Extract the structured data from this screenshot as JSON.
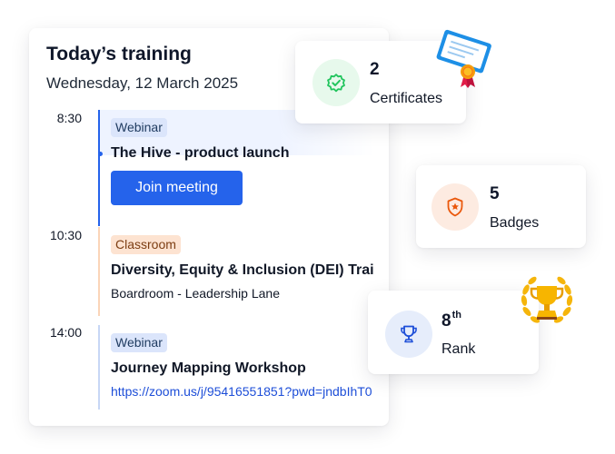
{
  "training": {
    "title": "Today’s training",
    "date": "Wednesday, 12 March 2025",
    "sessions": [
      {
        "time": "8:30",
        "tag": "Webinar",
        "name": "The Hive - product launch",
        "button_label": "Join  meeting"
      },
      {
        "time": "10:30",
        "tag": "Classroom",
        "name": "Diversity, Equity & Inclusion (DEI) Training",
        "location": "Boardroom - Leadership Lane"
      },
      {
        "time": "14:00",
        "tag": "Webinar",
        "name": "Journey Mapping Workshop",
        "link": "https://zoom.us/j/95416551851?pwd=jndbIhT0"
      }
    ]
  },
  "stats": {
    "certificates": {
      "value": "2",
      "label": "Certificates",
      "icon": "verified-badge-icon"
    },
    "badges": {
      "value": "5",
      "label": "Badges",
      "icon": "shield-star-icon"
    },
    "rank": {
      "value": "8",
      "suffix": "th",
      "label": "Rank",
      "icon": "trophy-icon"
    }
  },
  "decorations": {
    "certificate": "certificate-ribbon-icon",
    "trophy": "gold-trophy-laurel-icon"
  },
  "colors": {
    "primary": "#2563eb",
    "webinar_tag": "#dbe5fb",
    "classroom_tag": "#fde3d1",
    "certificates_accent": "#22c55e",
    "badges_accent": "#ea580c",
    "rank_accent": "#1d4ed8"
  }
}
